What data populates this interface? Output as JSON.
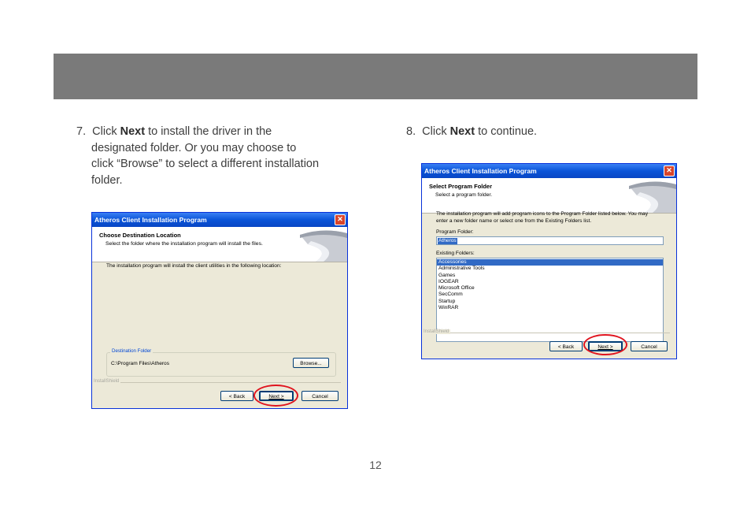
{
  "page": {
    "number": "12"
  },
  "steps": [
    {
      "num": "7.",
      "pre": "Click ",
      "bold": "Next",
      "post": " to install the driver in the",
      "lines": [
        "designated folder. Or you may choose to",
        "click “Browse” to select a different installation",
        "folder."
      ]
    },
    {
      "num": "8.",
      "pre": "Click ",
      "bold": "Next",
      "post": " to continue."
    }
  ],
  "dialog1": {
    "title": "Atheros Client Installation Program",
    "close": "✕",
    "heading": "Choose Destination Location",
    "subheading": "Select the folder where the installation program will install the files.",
    "body": "The installation program will install the client utilities in the following location:",
    "group_label": "Destination Folder",
    "path": "C:\\Program Files\\Atheros",
    "browse": "Browse...",
    "installshield": "InstallShield",
    "back": "< Back",
    "next": "Next >",
    "cancel": "Cancel"
  },
  "dialog2": {
    "title": "Atheros Client Installation Program",
    "close": "✕",
    "heading": "Select Program Folder",
    "subheading": "Select a program folder.",
    "body_line1": "The installation program will add program icons to the Program Folder listed below. You may",
    "body_line2": "enter a new folder name or select one from the Existing Folders list.",
    "program_folder_label": "Program Folder:",
    "program_folder_value": "Atheros",
    "existing_label": "Existing Folders:",
    "folders": [
      "Accessories",
      "Administrative Tools",
      "Games",
      "IOGEAR",
      "Microsoft Office",
      "SecComm",
      "Startup",
      "WinRAR"
    ],
    "installshield": "InstallShield",
    "back": "< Back",
    "next": "Next >",
    "cancel": "Cancel"
  },
  "colors": {
    "header_band": "#7a7a7a",
    "highlight_ring": "#e0141e",
    "titlebar": "#0a54d8"
  }
}
